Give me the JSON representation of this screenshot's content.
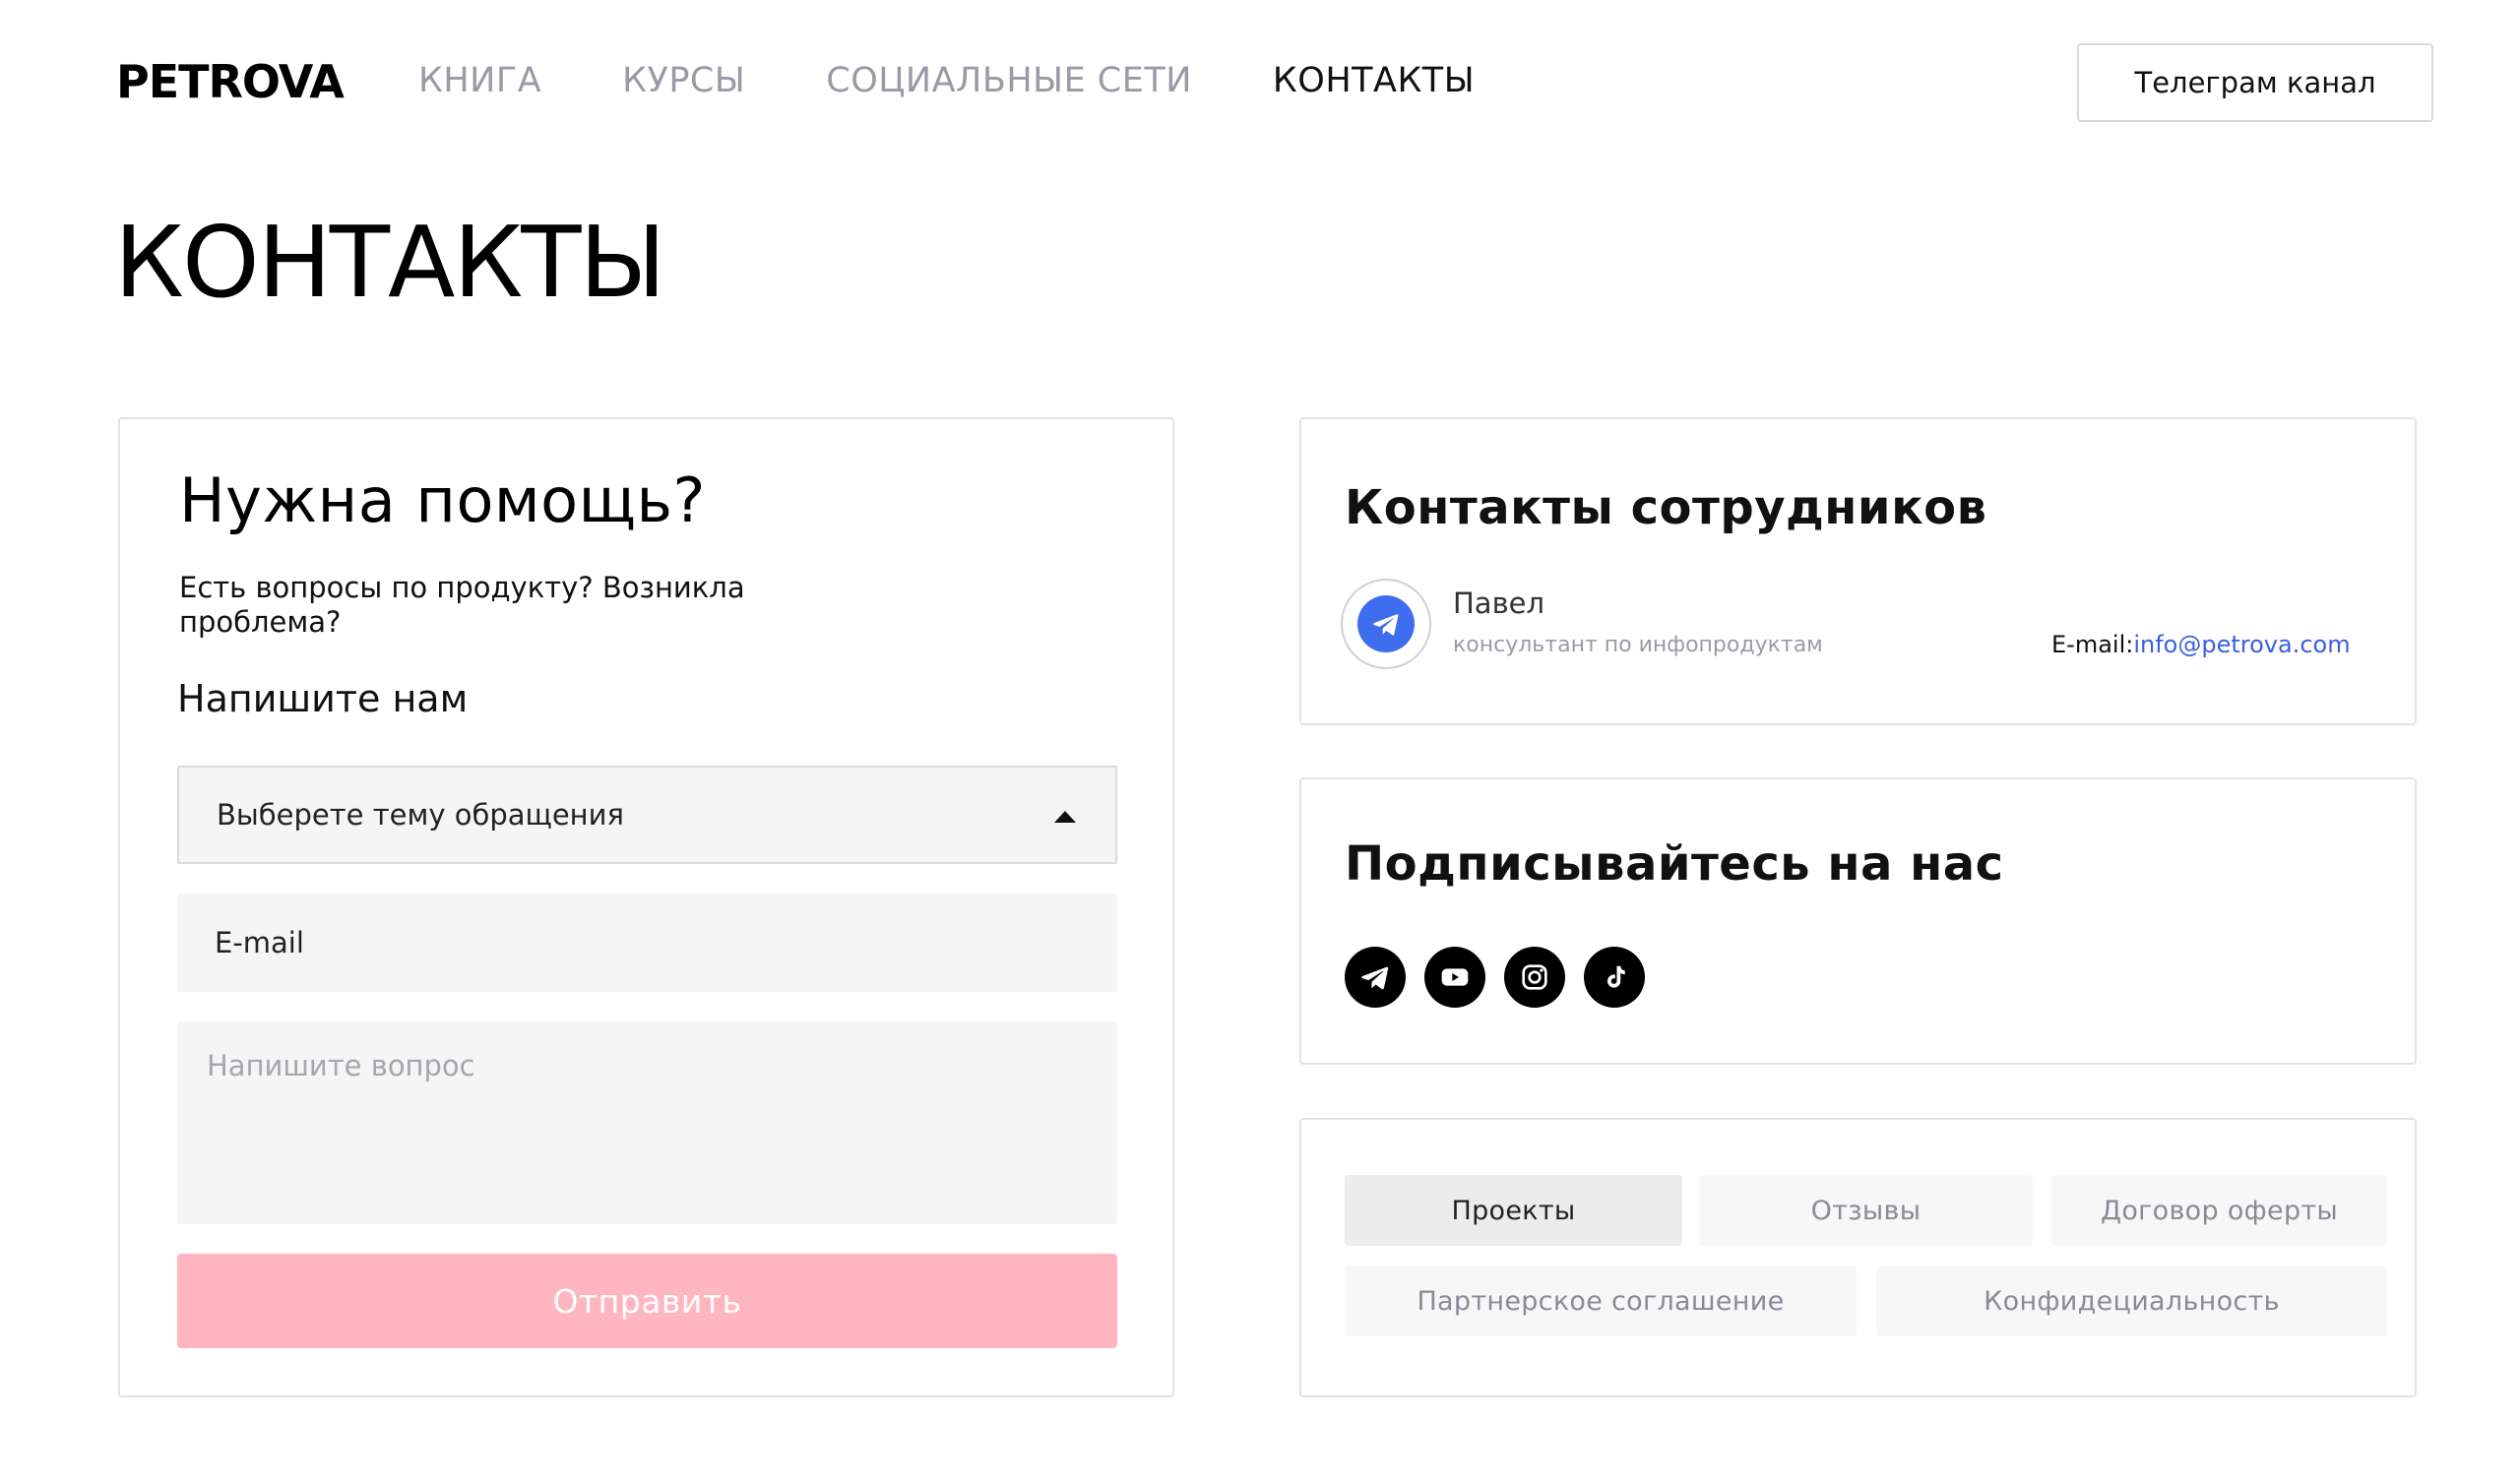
{
  "header": {
    "logo": "PETROVA",
    "nav": [
      {
        "label": "КНИГА",
        "active": false
      },
      {
        "label": "КУРСЫ",
        "active": false
      },
      {
        "label": "СОЦИАЛЬНЫЕ СЕТИ",
        "active": false
      },
      {
        "label": "КОНТАКТЫ",
        "active": true
      }
    ],
    "telegram_button": "Телеграм канал"
  },
  "page_title": "КОНТАКТЫ",
  "help": {
    "title": "Нужна помощь?",
    "subtitle": "Есть вопросы по продукту? Возникла проблема?",
    "write_us": "Напишите нам",
    "topic_select": "Выберете тему обращения",
    "email_value": "E-mail",
    "question_placeholder": "Напишите вопрос",
    "submit": "Отправить"
  },
  "staff": {
    "title": "Контакты сотрудников",
    "name": "Павел",
    "role": "консультант по инфопродуктам",
    "email_label": "E-mail:",
    "email": "info@petrova.com"
  },
  "social": {
    "title": "Подписывайтесь на нас",
    "icons": [
      "telegram-icon",
      "youtube-icon",
      "instagram-icon",
      "tiktok-icon"
    ]
  },
  "links": {
    "items": [
      "Проекты",
      "Отзывы",
      "Договор оферты",
      "Партнерское соглашение",
      "Конфидециальность"
    ],
    "active": "Проекты"
  },
  "colors": {
    "accent_pink": "#ffb6c1",
    "link_blue": "#3b5fe0",
    "avatar_blue": "#3f6df0",
    "nav_gray": "#9a9aa6"
  }
}
